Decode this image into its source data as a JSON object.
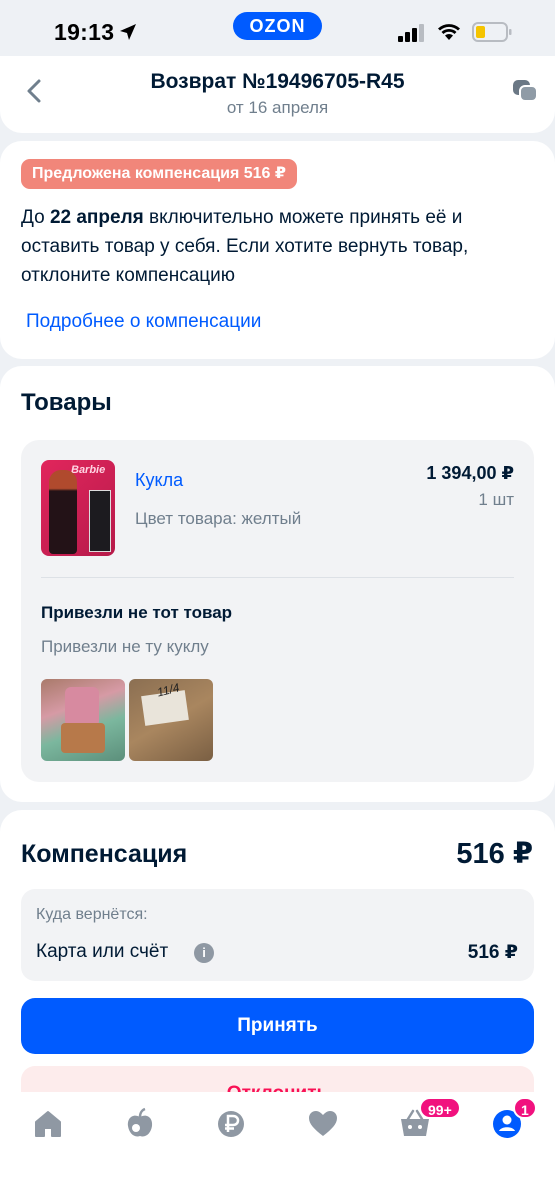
{
  "status_bar": {
    "time": "19:13",
    "app_logo": "OZON"
  },
  "header": {
    "title": "Возврат №19496705-R45",
    "subtitle": "от 16 апреля"
  },
  "offer": {
    "badge": "Предложена компенсация 516 ₽",
    "text_before": "До ",
    "deadline": "22 апреля",
    "text_after": " включительно можете принять её и оставить товар у себя. Если хотите вернуть товар, отклоните компенсацию",
    "link": "Подробнее о компенсации"
  },
  "goods": {
    "title": "Товары",
    "item": {
      "image_brand": "Barbie",
      "name": "Кукла",
      "color": "Цвет товара: желтый",
      "price": "1 394,00 ₽",
      "quantity": "1 шт"
    },
    "reason": "Привезли не тот товар",
    "reason_description": "Привезли не ту куклу",
    "photo2_mark": "11/4"
  },
  "compensation": {
    "title": "Компенсация",
    "amount": "516 ₽",
    "where_label": "Куда вернётся:",
    "destination": "Карта или счёт",
    "destination_amount": "516 ₽",
    "accept_button": "Принять",
    "decline_button": "Отклонить"
  },
  "tabbar": {
    "cart_badge": "99+",
    "profile_badge": "1"
  },
  "colors": {
    "accent": "#005bff",
    "badge_bg": "#f1867a",
    "text": "#001a34",
    "secondary_text": "#707f8d",
    "tab_badge": "#f1117e"
  }
}
